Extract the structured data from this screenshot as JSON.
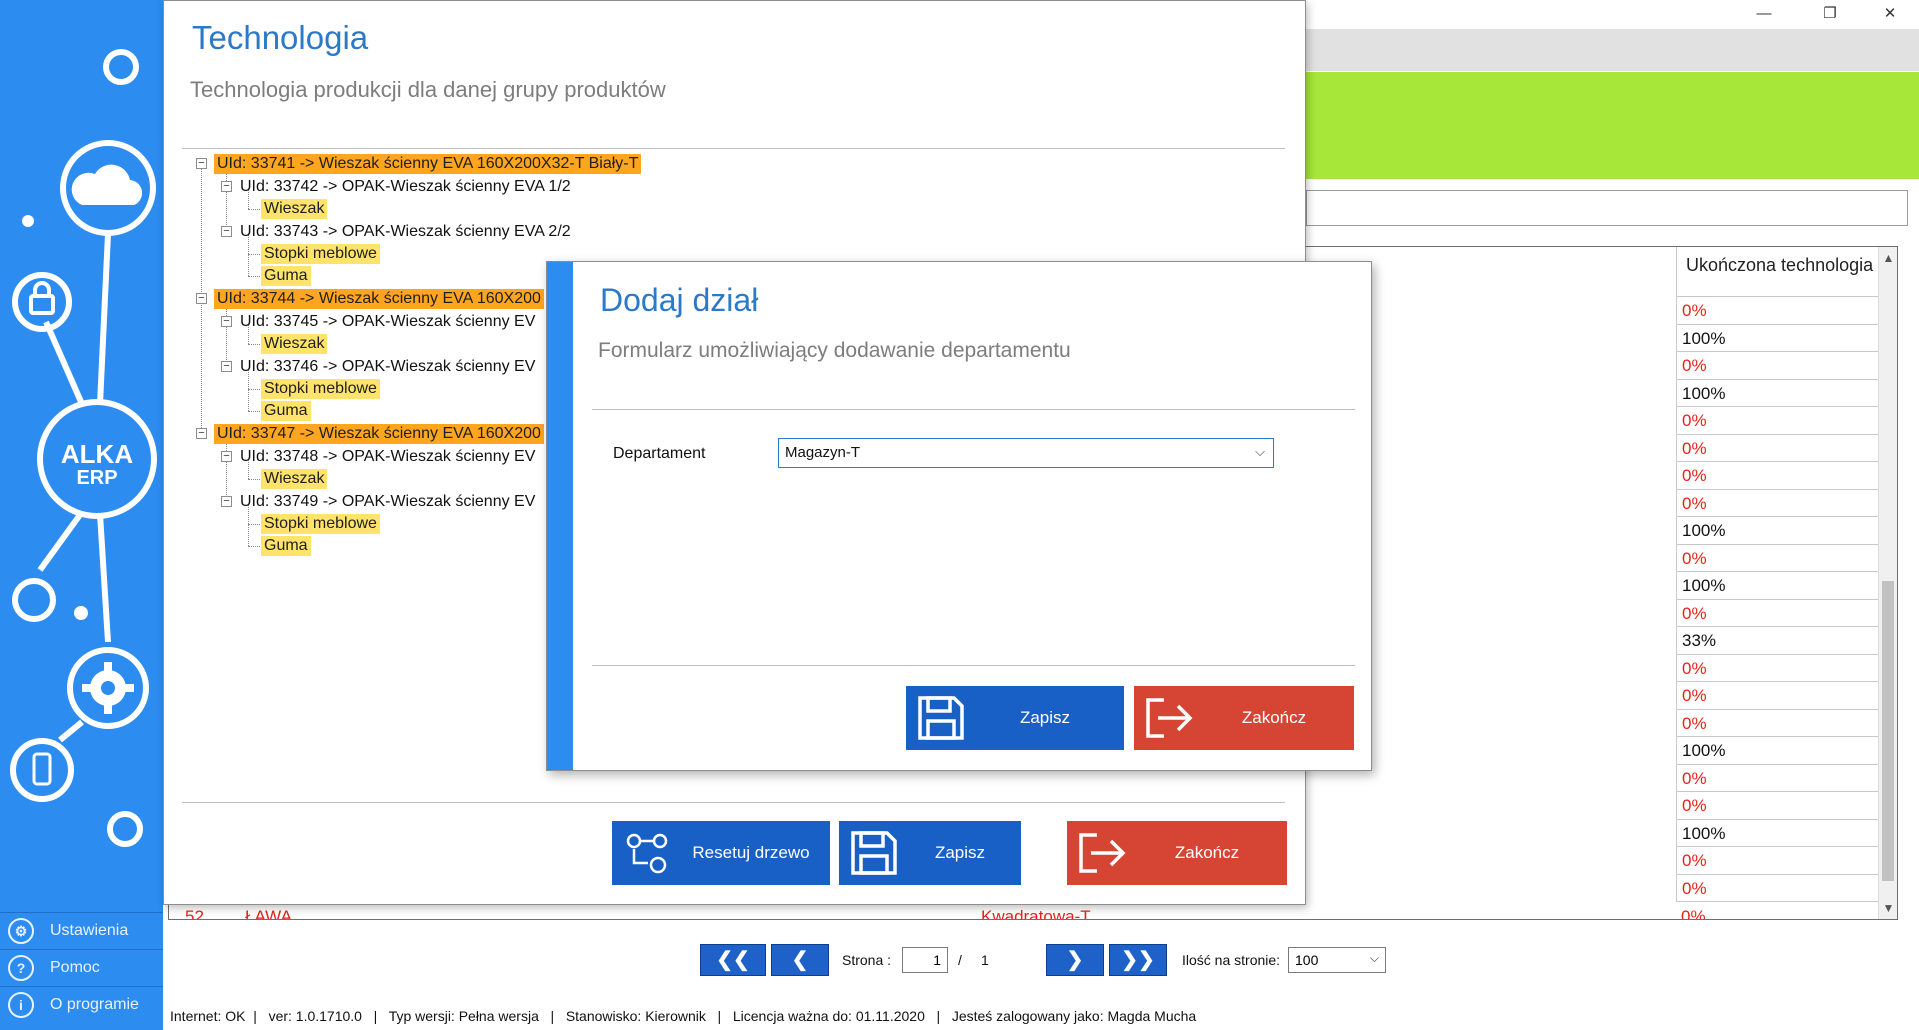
{
  "window_controls": {
    "minimize": "—",
    "restore": "❐",
    "close": "✕"
  },
  "grid": {
    "column_header": "Ukończona technologia",
    "rows": [
      "0%",
      "100%",
      "0%",
      "100%",
      "0%",
      "0%",
      "0%",
      "0%",
      "100%",
      "0%",
      "100%",
      "0%",
      "33%",
      "0%",
      "0%",
      "0%",
      "100%",
      "0%",
      "0%",
      "100%",
      "0%",
      "0%"
    ],
    "partial_row": {
      "id": "52",
      "name": "ŁAWA",
      "mid": "Kwadratowa-T",
      "value": "0%"
    }
  },
  "sidebar": {
    "logo_line1": "ALKA",
    "logo_line2": "ERP",
    "menu": [
      {
        "label": "Ustawienia",
        "icon": "gear-icon"
      },
      {
        "label": "Pomoc",
        "icon": "help-icon"
      },
      {
        "label": "O programie",
        "icon": "info-icon"
      }
    ]
  },
  "technologia": {
    "title": "Technologia",
    "subtitle": "Technologia produkcji dla danej grupy produktów",
    "tree": {
      "n1": "UId: 33741 -> Wieszak ścienny EVA 160X200X32-T Biały-T",
      "n1a": "UId: 33742 -> OPAK-Wieszak ścienny EVA   1/2",
      "n1a1": "Wieszak",
      "n1b": "UId: 33743 -> OPAK-Wieszak ścienny EVA   2/2",
      "n1b1": "Stopki meblowe",
      "n1b2": "Guma",
      "n2": "UId: 33744 -> Wieszak ścienny EVA 160X200",
      "n2a": "UId: 33745 -> OPAK-Wieszak ścienny EV",
      "n2a1": "Wieszak",
      "n2b": "UId: 33746 -> OPAK-Wieszak ścienny EV",
      "n2b1": "Stopki meblowe",
      "n2b2": "Guma",
      "n3": "UId: 33747 -> Wieszak ścienny EVA 160X200",
      "n3a": "UId: 33748 -> OPAK-Wieszak ścienny EV",
      "n3a1": "Wieszak",
      "n3b": "UId: 33749 -> OPAK-Wieszak ścienny EV",
      "n3b1": "Stopki meblowe",
      "n3b2": "Guma"
    },
    "buttons": {
      "reset": "Resetuj drzewo",
      "save": "Zapisz",
      "close": "Zakończ"
    }
  },
  "dialog": {
    "title": "Dodaj dział",
    "subtitle": "Formularz umożliwiający dodawanie departamentu",
    "field_label": "Departament",
    "field_value": "Magazyn-T",
    "buttons": {
      "save": "Zapisz",
      "close": "Zakończ"
    }
  },
  "pagination": {
    "first": "❮❮",
    "prev": "❮",
    "next": "❯",
    "last": "❯❯",
    "page_label": "Strona :",
    "page_value": "1",
    "separator": "/",
    "total_pages": "1",
    "per_page_label": "Ilość na stronie:",
    "per_page_value": "100"
  },
  "statusbar": "Internet: OK  |   ver: 1.0.1710.0   |   Typ wersji: Pełna wersja   |   Stanowisko: Kierownik   |   Licencja ważna do: 01.11.2020   |   Jesteś zalogowany jako: Magda Mucha",
  "colors": {
    "accent": "#2d8cf0",
    "button_blue": "#1960c6",
    "button_red": "#d64533",
    "tree_root": "#ffa51f",
    "tree_leaf": "#ffe36b",
    "green_band": "#a6e73a"
  }
}
